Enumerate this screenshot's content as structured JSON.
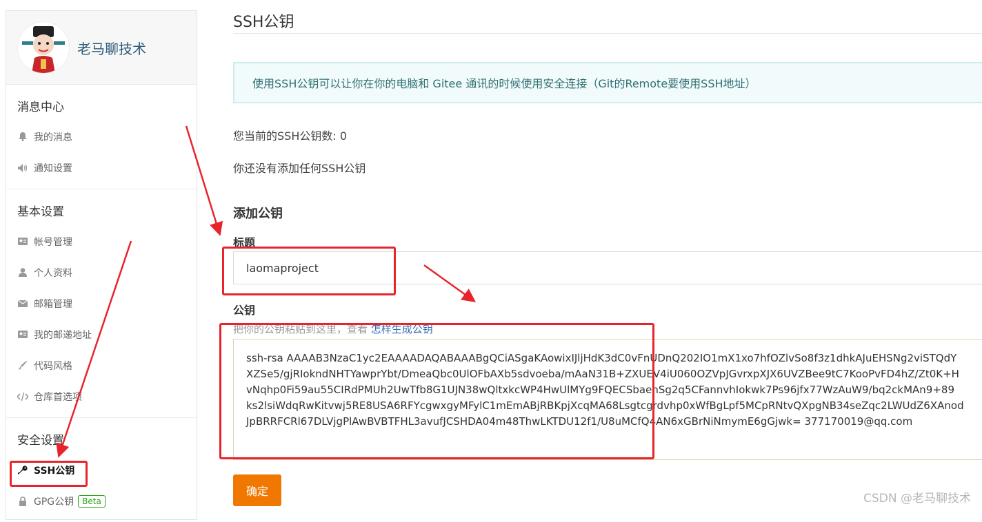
{
  "profile": {
    "username": "老马聊技术"
  },
  "sidebar": {
    "sections": [
      {
        "title": "消息中心",
        "items": [
          {
            "label": "我的消息",
            "icon": "bell-icon"
          },
          {
            "label": "通知设置",
            "icon": "speaker-icon"
          }
        ]
      },
      {
        "title": "基本设置",
        "items": [
          {
            "label": "帐号管理",
            "icon": "id-card-icon"
          },
          {
            "label": "个人资料",
            "icon": "user-icon"
          },
          {
            "label": "邮箱管理",
            "icon": "mail-icon"
          },
          {
            "label": "我的邮递地址",
            "icon": "address-card-icon"
          },
          {
            "label": "代码风格",
            "icon": "brush-icon"
          },
          {
            "label": "仓库首选项",
            "icon": "code-icon"
          }
        ]
      },
      {
        "title": "安全设置",
        "items": [
          {
            "label": "SSH公钥",
            "icon": "key-icon",
            "active": true
          },
          {
            "label": "GPG公钥",
            "icon": "lock-icon",
            "badge": "Beta"
          }
        ]
      }
    ]
  },
  "main": {
    "title": "SSH公钥",
    "info": "使用SSH公钥可以让你在你的电脑和 Gitee 通讯的时候使用安全连接（Git的Remote要使用SSH地址）",
    "key_count": "您当前的SSH公钥数: 0",
    "no_keys": "你还没有添加任何SSH公钥",
    "form": {
      "heading": "添加公钥",
      "title_label": "标题",
      "title_value": "laomaproject",
      "key_label": "公钥",
      "hint_prefix": "把你的公钥粘贴到这里，查看",
      "hint_link": "怎样生成公钥",
      "key_value": "ssh-rsa AAAAB3NzaC1yc2EAAAADAQABAAABgQCiASgaKAowixIJljHdK3dC0vFnUDnQ202IO1mX1xo7hfOZlvSo8f3z1dhkAJuEHSNg2viSTQdY\nXZSe5/gjRIokndNHTYawprYbt/DmeaQbc0UlOFbAXb5sdvoeba/mAaN31B+ZXUEV4iU060OZVpJGvrxpXJX6UVZBee9tC7KooPvFD4hZ/Zt0K+H\nvNqhp0Fi59au55CIRdPMUh2UwTfb8G1UJN38wQltxkcWP4HwUlMYg9FQECSbaenSg2q5CFannvhIokwk7Ps96jfx77WzAuW9/bq2ckMAn9+89\nks2lsiWdqRwKitvwj5RE8USA6RFYcgwxgyMFylC1mEmABjRBKpjXcqMA68Lsgtcgrdvhp0xWfBgLpf5MCpRNtvQXpgNB34seZqc2LWUdZ6XAnod\nJpBRRFCRl67DLVjgPlAwBVBTFHL3avufJCSHDA04m48ThwLKTDU12f1/U8uMCfQ4AN6xGBrNiNmymE6gGjwk= 377170019@qq.com",
      "submit_label": "确定"
    }
  },
  "watermark": "CSDN @老马聊技术",
  "colors": {
    "accent": "#f07800",
    "annotation": "#e8242b",
    "info_bg": "#f2fbfb"
  }
}
